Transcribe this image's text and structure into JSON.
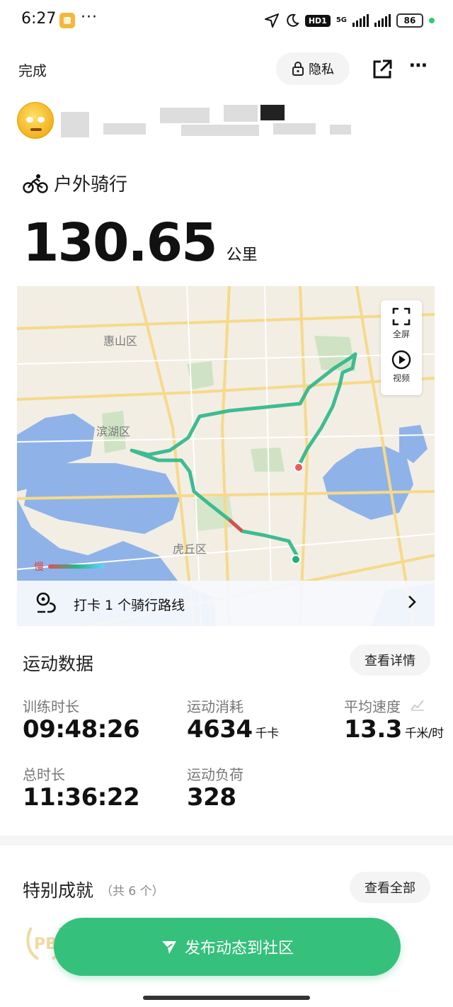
{
  "status_bar": {
    "time": "6:27",
    "dots": "···",
    "hd": "HD1",
    "network": "5G",
    "battery": "86"
  },
  "header": {
    "done_label": "完成",
    "privacy_label": "隐私"
  },
  "activity": {
    "type_label": "户外骑行",
    "distance": "130.65",
    "distance_unit": "公里"
  },
  "map": {
    "labels": [
      "惠山区",
      "滨湖区",
      "虎丘区"
    ],
    "fullscreen_label": "全屏",
    "video_label": "视频",
    "legend_slow": "慢",
    "checkin_text": "打卡 1 个骑行路线"
  },
  "stats": {
    "title": "运动数据",
    "detail_button": "查看详情",
    "items": [
      {
        "label": "训练时长",
        "value": "09:48:26",
        "unit": ""
      },
      {
        "label": "运动消耗",
        "value": "4634",
        "unit": "千卡"
      },
      {
        "label": "平均速度",
        "value": "13.3",
        "unit": "千米/时"
      },
      {
        "label": "总时长",
        "value": "11:36:22",
        "unit": ""
      },
      {
        "label": "运动负荷",
        "value": "328",
        "unit": ""
      }
    ]
  },
  "achievements": {
    "title": "特别成就",
    "count_text": "（共 6 个）",
    "view_all_button": "查看全部"
  },
  "publish_button": "发布动态到社区",
  "colors": {
    "accent_green": "#35c07b",
    "route_green": "#2bb58a",
    "water_blue": "#8fb3e8"
  }
}
